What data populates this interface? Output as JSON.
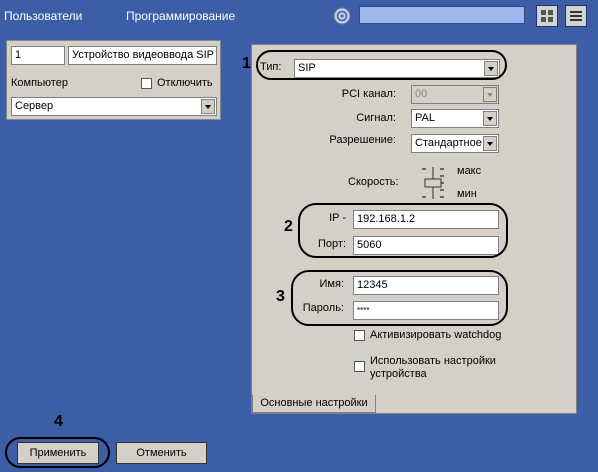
{
  "tabs": {
    "users": "Пользователи",
    "programming": "Программирование"
  },
  "top": {
    "search_value": ""
  },
  "left": {
    "id_value": "1",
    "name_value": "Устройство видеоввода SIP",
    "computer_label": "Компьютер",
    "disable_label": "Отключить",
    "server_value": "Сервер"
  },
  "device": {
    "type_label": "Тип:",
    "type_value": "SIP",
    "pci_label": "PCI канал:",
    "pci_value": "00",
    "signal_label": "Сигнал:",
    "signal_value": "PAL",
    "resolution_label": "Разрешение:",
    "resolution_value": "Стандартное",
    "speed_label": "Скорость:",
    "speed_max": "макс",
    "speed_min": "мин",
    "ip_label": "IP -",
    "ip_value": "192.168.1.2",
    "port_label": "Порт:",
    "port_value": "5060",
    "name_label": "Имя:",
    "name_value": "12345",
    "password_label": "Пароль:",
    "password_value": "****",
    "watchdog_label": "Активизировать  watchdog",
    "device_settings_label_1": "Использовать настройки",
    "device_settings_label_2": "устройства",
    "tab_label": "Основные настройки"
  },
  "callouts": [
    "1",
    "2",
    "3",
    "4"
  ],
  "buttons": {
    "apply": "Применить",
    "cancel": "Отменить"
  },
  "colors": {
    "background": "#3c5fa7",
    "panel": "#d4d0c8",
    "search": "#9fb6ea"
  }
}
